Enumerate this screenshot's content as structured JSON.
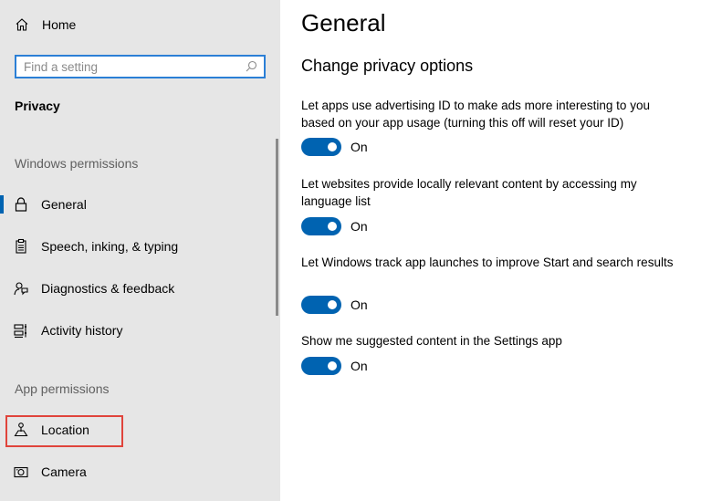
{
  "sidebar": {
    "home_label": "Home",
    "search_placeholder": "Find a setting",
    "section_title": "Privacy",
    "windows_permissions_header": "Windows permissions",
    "app_permissions_header": "App permissions",
    "items": [
      {
        "label": "General",
        "icon": "lock-icon"
      },
      {
        "label": "Speech, inking, & typing",
        "icon": "clipboard-icon"
      },
      {
        "label": "Diagnostics & feedback",
        "icon": "feedback-icon"
      },
      {
        "label": "Activity history",
        "icon": "activity-history-icon"
      },
      {
        "label": "Location",
        "icon": "location-icon"
      },
      {
        "label": "Camera",
        "icon": "camera-icon"
      }
    ],
    "selected": "General"
  },
  "main": {
    "title": "General",
    "subtitle": "Change privacy options",
    "options": [
      {
        "description": "Let apps use advertising ID to make ads more interesting to you based on your app usage (turning this off will reset your ID)",
        "state": "On"
      },
      {
        "description": "Let websites provide locally relevant content by accessing my language list",
        "state": "On"
      },
      {
        "description": "Let Windows track app launches to improve Start and search results",
        "state": "On"
      },
      {
        "description": "Show me suggested content in the Settings app",
        "state": "On"
      }
    ]
  },
  "colors": {
    "accent": "#0063b1",
    "search_border": "#2b7fd6",
    "highlight_box": "#e0443b",
    "sidebar_bg": "#e6e6e6"
  }
}
